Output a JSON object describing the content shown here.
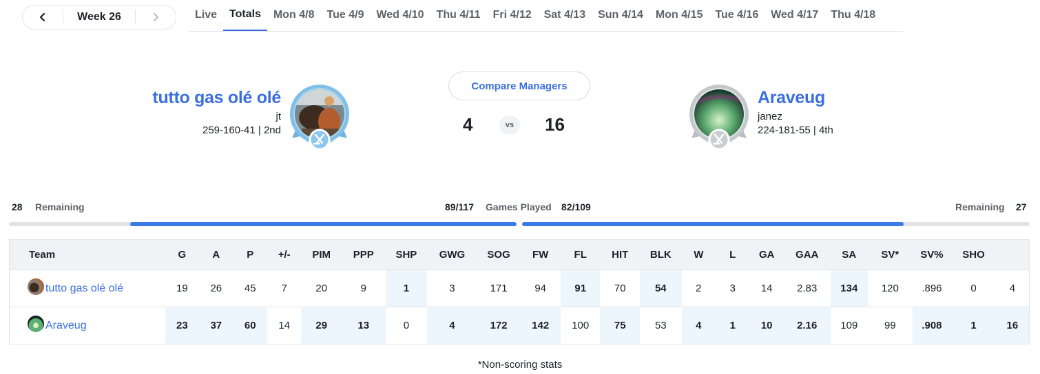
{
  "week_nav": {
    "label": "Week 26"
  },
  "tabs": [
    "Live",
    "Totals",
    "Mon 4/8",
    "Tue 4/9",
    "Wed 4/10",
    "Thu 4/11",
    "Fri 4/12",
    "Sat 4/13",
    "Sun 4/14",
    "Mon 4/15",
    "Tue 4/16",
    "Wed 4/17",
    "Thu 4/18"
  ],
  "active_tab": "Totals",
  "matchup": {
    "compare_label": "Compare Managers",
    "vs_label": "vs",
    "left": {
      "name": "tutto gas olé olé",
      "manager": "jt",
      "record": "259-160-41 | 2nd",
      "score": "4"
    },
    "right": {
      "name": "Araveug",
      "manager": "janez",
      "record": "224-181-55 | 4th",
      "score": "16"
    }
  },
  "games_played": {
    "label": "Games Played",
    "remaining_label": "Remaining",
    "left": {
      "remaining": "28",
      "played": "89/117",
      "fraction": 0.7607
    },
    "right": {
      "remaining": "27",
      "played": "82/109",
      "fraction": 0.7523
    }
  },
  "table": {
    "team_header": "Team",
    "columns": [
      "G",
      "A",
      "P",
      "+/-",
      "PIM",
      "PPP",
      "SHP",
      "GWG",
      "SOG",
      "FW",
      "FL",
      "HIT",
      "BLK",
      "W",
      "L",
      "GA",
      "GAA",
      "SA",
      "SV*",
      "SV%",
      "SHO",
      ""
    ],
    "rows": [
      {
        "team": "tutto gas olé olé",
        "values": [
          "19",
          "26",
          "45",
          "7",
          "20",
          "9",
          "1",
          "3",
          "171",
          "94",
          "91",
          "70",
          "54",
          "2",
          "3",
          "14",
          "2.83",
          "134",
          "120",
          ".896",
          "0",
          "4"
        ],
        "wins": [
          6,
          10,
          12,
          17
        ]
      },
      {
        "team": "Araveug",
        "values": [
          "23",
          "37",
          "60",
          "14",
          "29",
          "13",
          "0",
          "4",
          "172",
          "142",
          "100",
          "75",
          "53",
          "4",
          "1",
          "10",
          "2.16",
          "109",
          "99",
          ".908",
          "1",
          "16"
        ],
        "wins": [
          0,
          1,
          2,
          4,
          5,
          7,
          8,
          9,
          11,
          13,
          14,
          15,
          16,
          19,
          20,
          21
        ]
      }
    ],
    "green_column": 3
  },
  "footnote": "*Non-scoring stats",
  "colors": {
    "accent": "#3b6fe0",
    "win_bg": "#edf5fd",
    "positive": "#188a33",
    "header_bg": "#f0f3f5"
  }
}
